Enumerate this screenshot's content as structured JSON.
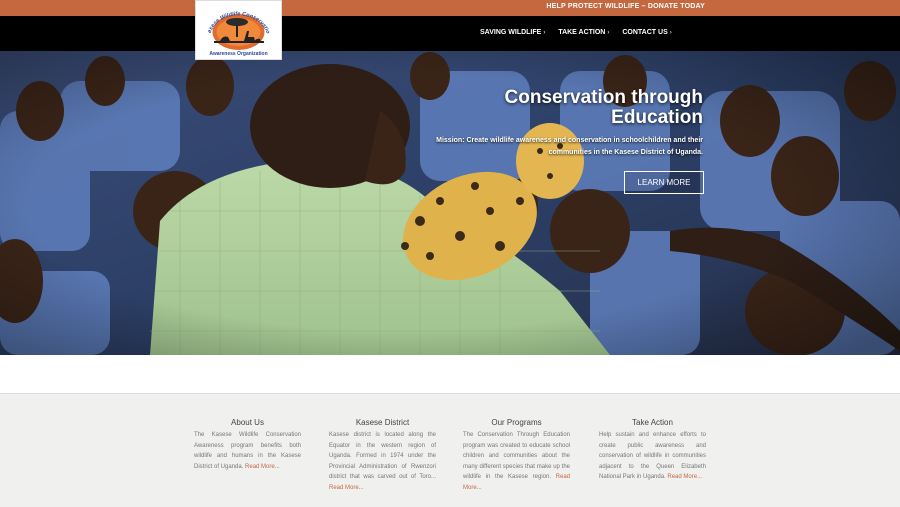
{
  "topbar": {
    "donate_label": "HELP PROTECT WILDLIFE – DONATE TODAY",
    "bg_color": "#c5683f"
  },
  "logo": {
    "top_text": "Kasese Wildlife Conservation",
    "bottom_text": "Awareness Organization"
  },
  "nav": {
    "items": [
      {
        "label": "SAVING WILDLIFE",
        "icon": "chevron-down-icon"
      },
      {
        "label": "TAKE ACTION",
        "icon": "chevron-down-icon"
      },
      {
        "label": "CONTACT US",
        "icon": "chevron-down-icon"
      }
    ]
  },
  "hero": {
    "title_line1": "Conservation through",
    "title_line2": "Education",
    "mission": "Mission: Create wildlife awareness and conservation in schoolchildren and their communities in the Kasese District of Uganda.",
    "button_label": "LEARN MORE"
  },
  "footer": {
    "columns": [
      {
        "title": "About Us",
        "text": "The Kasese Wildlife Conservation Awareness program benefits both wildlife and humans in the Kasese District of Uganda.",
        "link": "Read More..."
      },
      {
        "title": "Kasese District",
        "text": "Kasese district is located along the Equator in the western region of Uganda. Formed in 1974 under the Provincial Administration of Rwenzori district that was carved out of Toro...",
        "link": "Read More..."
      },
      {
        "title": "Our Programs",
        "text": "The Conservation Through Education program was created to educate school children and communities about the many different species that make up the wildlife in the Kasese region.",
        "link": "Read More..."
      },
      {
        "title": "Take Action",
        "text": "Help sustain and enhance efforts to create public awareness and conservation of wildlife in communities adjacent to the Queen Elizabeth National Park in Uganda.",
        "link": "Read More..."
      }
    ]
  }
}
